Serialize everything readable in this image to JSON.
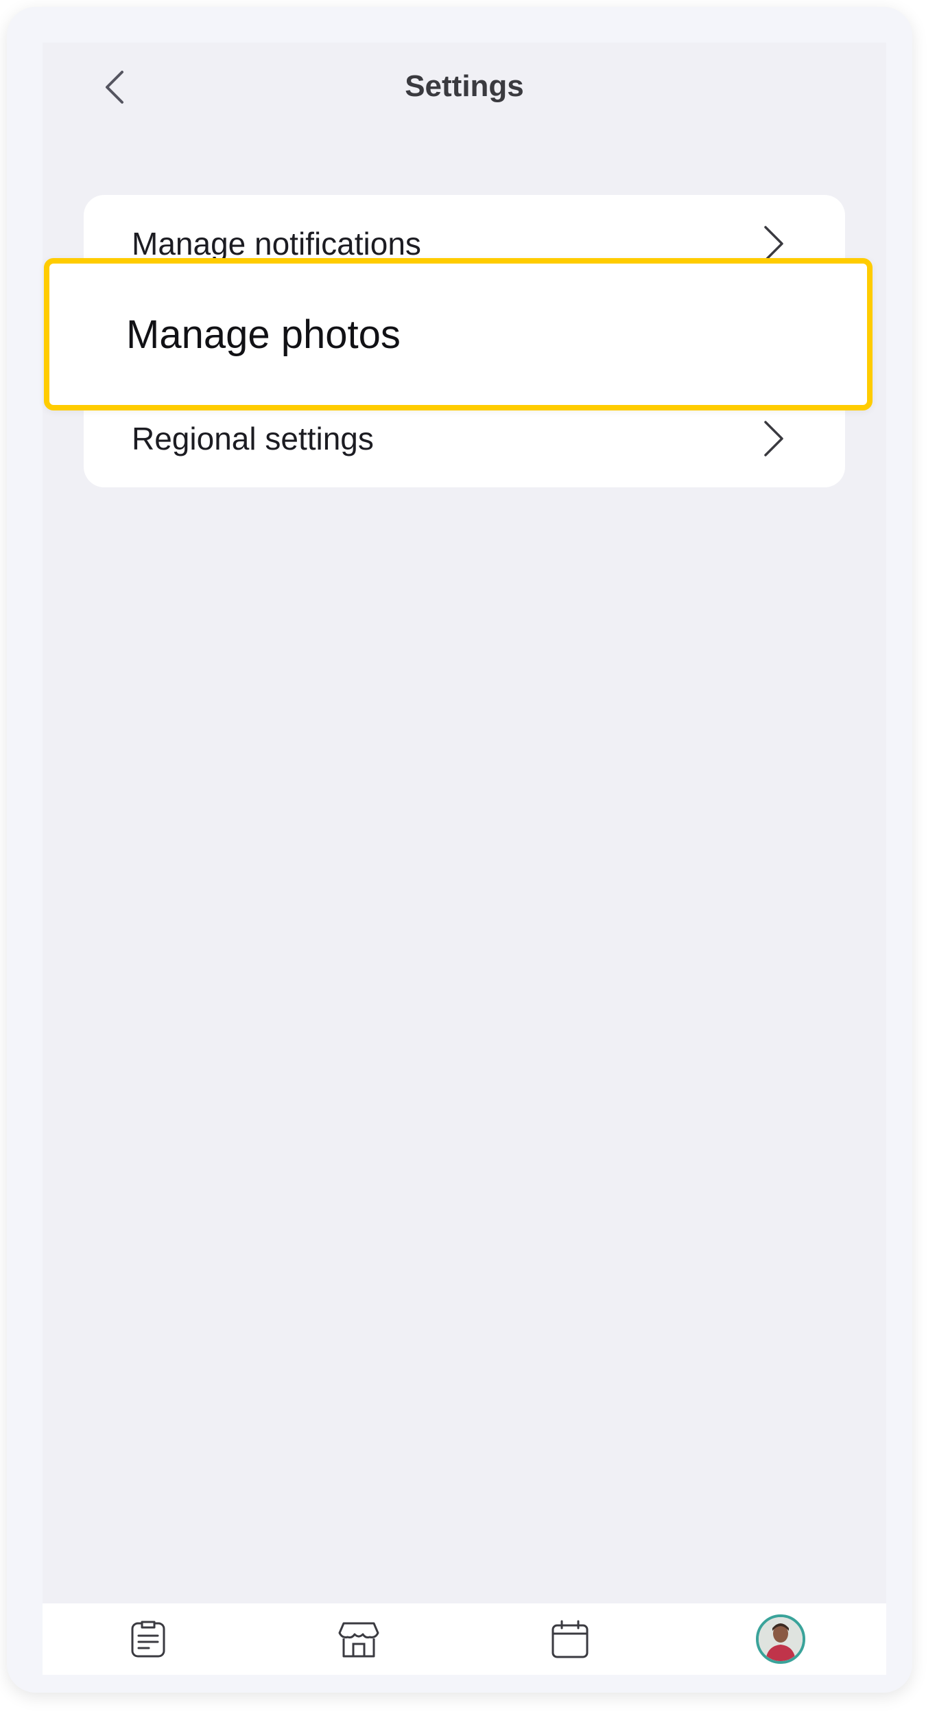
{
  "header": {
    "back_icon": "chevron-left-icon",
    "title": "Settings"
  },
  "settings": {
    "items": [
      {
        "label": "Manage notifications",
        "icon": "chevron-right-icon"
      },
      {
        "label": "Manage photos",
        "highlighted": true
      },
      {
        "label": "Regional settings",
        "icon": "chevron-right-icon"
      }
    ]
  },
  "tabbar": {
    "tabs": [
      {
        "icon": "clipboard-icon"
      },
      {
        "icon": "store-icon"
      },
      {
        "icon": "calendar-icon"
      },
      {
        "icon": "profile-avatar",
        "active": true
      }
    ]
  },
  "colors": {
    "highlight_border": "#ffcc00",
    "avatar_ring": "#3aa39a",
    "background": "#f0f0f5"
  }
}
